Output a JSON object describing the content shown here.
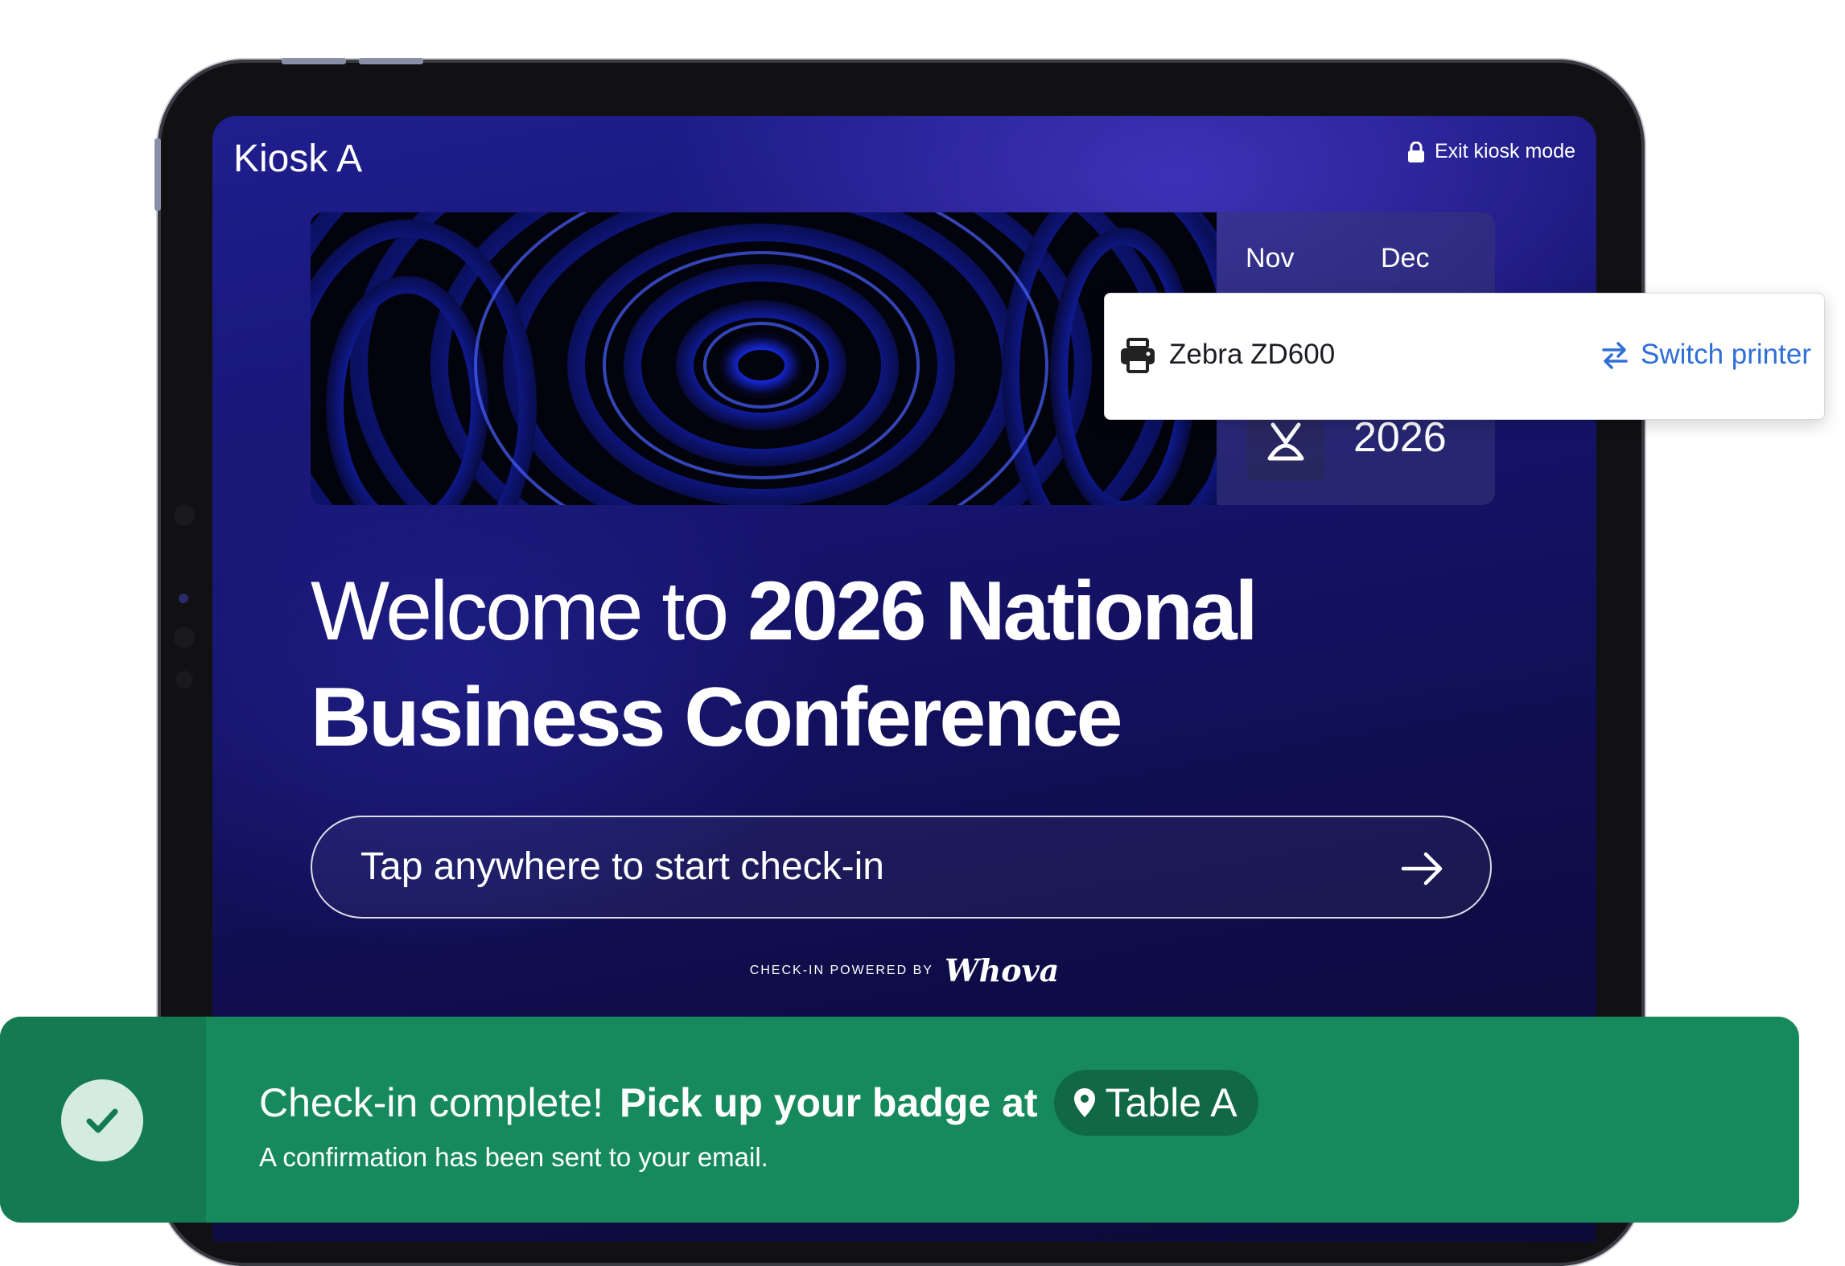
{
  "kiosk": {
    "title": "Kiosk A",
    "exit_label": "Exit kiosk mode"
  },
  "banner": {
    "month_start": "Nov",
    "month_end": "Dec",
    "year": "2026"
  },
  "welcome": {
    "line_light": "Welcome to ",
    "line_bold_1": "2026 National",
    "line_bold_2": "Business Conference"
  },
  "cta": {
    "label": "Tap anywhere to start check-in"
  },
  "powered": {
    "label": "CHECK-IN POWERED BY",
    "brand": "Whova"
  },
  "printer": {
    "name": "Zebra ZD600",
    "switch_label": "Switch printer"
  },
  "toast": {
    "title_light": "Check-in complete!",
    "title_bold": "Pick up your badge at",
    "location": "Table A",
    "subtitle": "A confirmation has been sent to your email."
  },
  "colors": {
    "success": "#178a5d",
    "link": "#2f6fd8",
    "screen_bg": "#16146e"
  },
  "icons": [
    "lock-icon",
    "arrow-right-icon",
    "printer-icon",
    "switch-icon",
    "map-pin-icon",
    "check-icon",
    "event-logo-icon"
  ]
}
